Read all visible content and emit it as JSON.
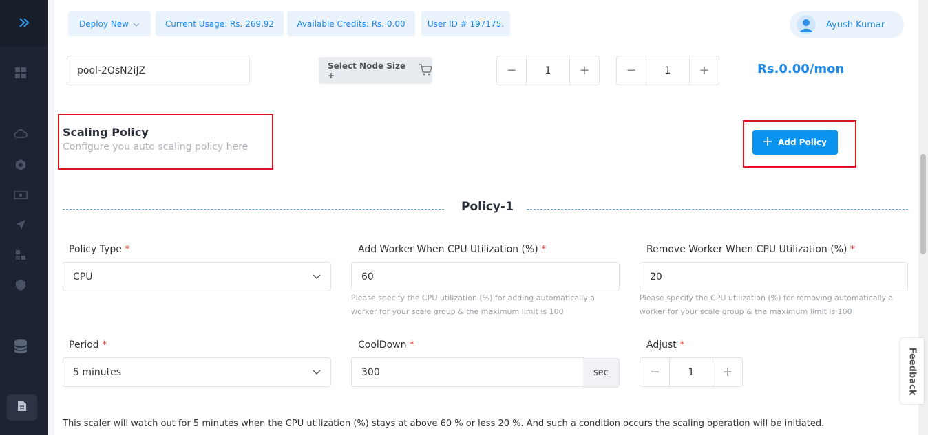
{
  "sidebar": {
    "expand_icon": "double-chevron-right-icon",
    "items": [
      "dashboard-icon",
      "cloud-icon",
      "kubernetes-icon",
      "billing-icon",
      "rocket-icon",
      "network-icon",
      "shield-icon",
      "database-icon"
    ],
    "bottom_icon": "document-icon"
  },
  "topbar": {
    "deploy_label": "Deploy New",
    "usage_label": "Current Usage: Rs. 269.92",
    "credits_label": "Available Credits: Rs. 0.00",
    "user_id_label": "User ID # 197175.",
    "user_name": "Ayush Kumar"
  },
  "pool": {
    "name": "pool-2OsN2iJZ",
    "node_size_label": "Select Node Size +",
    "min_nodes": "1",
    "max_nodes": "1",
    "price": "Rs.0.00/mon"
  },
  "scaling_policy": {
    "title": "Scaling Policy",
    "subtitle": "Configure you auto scaling policy here",
    "add_button": "Add Policy"
  },
  "policy": {
    "title": "Policy-1",
    "policy_type_label": "Policy Type",
    "policy_type_value": "CPU",
    "add_worker_label": "Add Worker When CPU Utilization (%)",
    "add_worker_value": "60",
    "add_worker_help": "Please specify the CPU utilization (%) for adding automatically a worker for your scale group & the maximum limit is 100",
    "remove_worker_label": "Remove Worker When CPU Utilization (%)",
    "remove_worker_value": "20",
    "remove_worker_help": "Please specify the CPU utilization (%) for removing automatically a worker for your scale group & the maximum limit is 100",
    "period_label": "Period",
    "period_value": "5 minutes",
    "cooldown_label": "CoolDown",
    "cooldown_value": "300",
    "cooldown_unit": "sec",
    "adjust_label": "Adjust",
    "adjust_value": "1",
    "required_mark": "*"
  },
  "summary": "This scaler will watch out for 5 minutes when the CPU utilization (%) stays at above 60 % or less 20 %. And such a condition occurs the scaling operation will be initiated.",
  "feedback_label": "Feedback",
  "colors": {
    "accent": "#1e88e5",
    "button": "#0b93f0",
    "highlight": "#e0141e",
    "sidebar": "#1d2332"
  }
}
